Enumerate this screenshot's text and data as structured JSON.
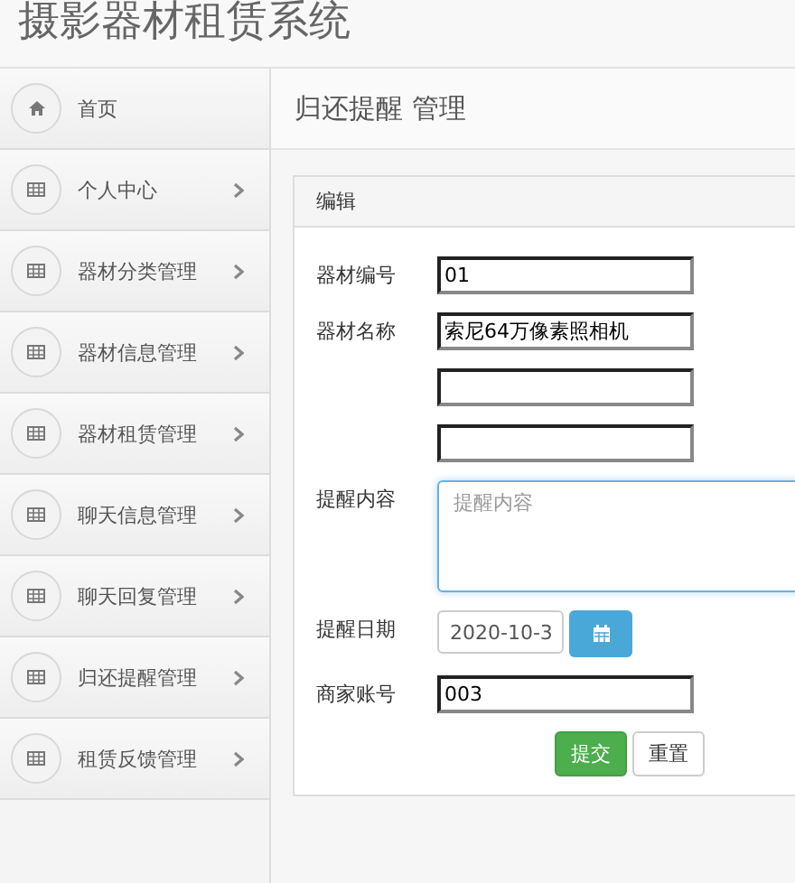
{
  "app_title": "摄影器材租赁系统",
  "sidebar": {
    "items": [
      {
        "label": "首页",
        "kind": "home",
        "arrow": false
      },
      {
        "label": "个人中心",
        "kind": "grid",
        "arrow": true
      },
      {
        "label": "器材分类管理",
        "kind": "grid",
        "arrow": true
      },
      {
        "label": "器材信息管理",
        "kind": "grid",
        "arrow": true
      },
      {
        "label": "器材租赁管理",
        "kind": "grid",
        "arrow": true
      },
      {
        "label": "聊天信息管理",
        "kind": "grid",
        "arrow": true
      },
      {
        "label": "聊天回复管理",
        "kind": "grid",
        "arrow": true
      },
      {
        "label": "归还提醒管理",
        "kind": "grid",
        "arrow": true
      },
      {
        "label": "租赁反馈管理",
        "kind": "grid",
        "arrow": true
      }
    ]
  },
  "page_title": "归还提醒 管理",
  "panel": {
    "title": "编辑",
    "fields": [
      {
        "kind": "input",
        "label": "器材编号",
        "value": "01"
      },
      {
        "kind": "input",
        "label": "器材名称",
        "value": "索尼64万像素照相机"
      },
      {
        "kind": "input"
      },
      {
        "kind": "input"
      },
      {
        "kind": "textarea",
        "label": "提醒内容",
        "placeholder": "提醒内容"
      },
      {
        "kind": "date",
        "label": "提醒日期",
        "value": "2020-10-3"
      },
      {
        "kind": "input",
        "label": "商家账号",
        "value": "003"
      }
    ],
    "buttons": [
      {
        "label": "提交",
        "kind": "primary"
      },
      {
        "label": "重置",
        "kind": "default"
      }
    ]
  }
}
